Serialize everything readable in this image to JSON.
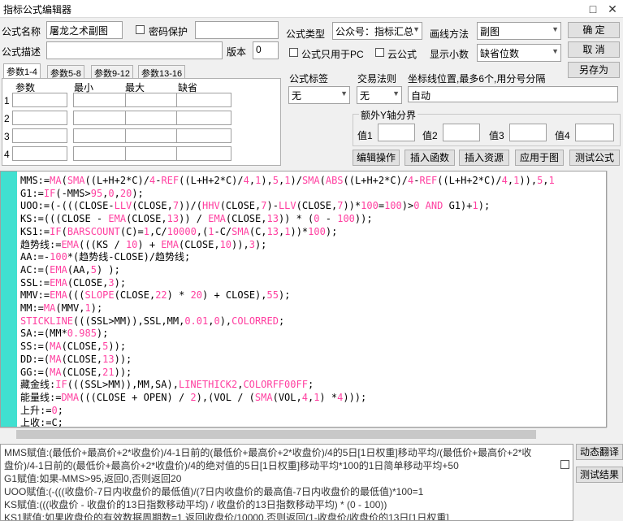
{
  "window": {
    "title": "指标公式编辑器",
    "restore_glyph": "□",
    "close_glyph": "✕"
  },
  "form": {
    "name_label": "公式名称",
    "name_value": "屠龙之术副图",
    "password_label": "密码保护",
    "desc_label": "公式描述",
    "version_label": "版本",
    "version_value": "0",
    "type_label": "公式类型",
    "type_value": "公众号：指标汇总",
    "pc_only_label": "公式只用于PC",
    "cloud_label": "云公式",
    "draw_method_label": "画线方法",
    "draw_method_value": "副图",
    "decimal_label": "显示小数",
    "decimal_value": "缺省位数"
  },
  "buttons": {
    "ok": "确  定",
    "cancel": "取  消",
    "save_as": "另存为",
    "edit_op": "编辑操作",
    "insert_func": "插入函数",
    "insert_res": "插入资源",
    "apply_chart": "应用于图",
    "test_formula": "测试公式",
    "dynamic_translate": "动态翻译",
    "test_result": "测试结果"
  },
  "tabs": [
    "参数1-4",
    "参数5-8",
    "参数9-12",
    "参数13-16"
  ],
  "param_headers": [
    "参数",
    "最小",
    "最大",
    "缺省"
  ],
  "param_rows": [
    "1",
    "2",
    "3",
    "4"
  ],
  "tag": {
    "label": "公式标签",
    "value": "无"
  },
  "trade": {
    "label": "交易法则",
    "value": "无"
  },
  "axis": {
    "label": "坐标线位置,最多6个,用分号分隔",
    "value": "自动"
  },
  "yaxis": {
    "label": "额外Y轴分界",
    "v1": "值1",
    "v2": "值2",
    "v3": "值3",
    "v4": "值4"
  },
  "code": [
    [
      [
        "MMS:=",
        "t"
      ],
      [
        "MA",
        "k"
      ],
      [
        "(",
        "t"
      ],
      [
        "SMA",
        "k"
      ],
      [
        "((L+H+2*C)/",
        "t"
      ],
      [
        "4",
        "n"
      ],
      [
        "-",
        "t"
      ],
      [
        "REF",
        "k"
      ],
      [
        "((L+H+2*C)/",
        "t"
      ],
      [
        "4",
        "n"
      ],
      [
        ",",
        "t"
      ],
      [
        "1",
        "n"
      ],
      [
        "),",
        "t"
      ],
      [
        "5",
        "n"
      ],
      [
        ",",
        "t"
      ],
      [
        "1",
        "n"
      ],
      [
        ")/",
        "t"
      ],
      [
        "SMA",
        "k"
      ],
      [
        "(",
        "t"
      ],
      [
        "ABS",
        "k"
      ],
      [
        "((L+H+2*C)/",
        "t"
      ],
      [
        "4",
        "n"
      ],
      [
        "-",
        "t"
      ],
      [
        "REF",
        "k"
      ],
      [
        "((L+H+2*C)/",
        "t"
      ],
      [
        "4",
        "n"
      ],
      [
        ",",
        "t"
      ],
      [
        "1",
        "n"
      ],
      [
        ")),",
        "t"
      ],
      [
        "5",
        "n"
      ],
      [
        ",",
        "t"
      ],
      [
        "1",
        "n"
      ]
    ],
    [
      [
        "G1:=",
        "t"
      ],
      [
        "IF",
        "k"
      ],
      [
        "(-MMS>",
        "t"
      ],
      [
        "95",
        "n"
      ],
      [
        ",",
        "t"
      ],
      [
        "0",
        "n"
      ],
      [
        ",",
        "t"
      ],
      [
        "20",
        "n"
      ],
      [
        ");",
        "t"
      ]
    ],
    [
      [
        "UOO:=(-(((CLOSE-",
        "t"
      ],
      [
        "LLV",
        "k"
      ],
      [
        "(CLOSE,",
        "t"
      ],
      [
        "7",
        "n"
      ],
      [
        "))/(",
        "t"
      ],
      [
        "HHV",
        "k"
      ],
      [
        "(CLOSE,",
        "t"
      ],
      [
        "7",
        "n"
      ],
      [
        ")-",
        "t"
      ],
      [
        "LLV",
        "k"
      ],
      [
        "(CLOSE,",
        "t"
      ],
      [
        "7",
        "n"
      ],
      [
        "))*",
        "t"
      ],
      [
        "100",
        "n"
      ],
      [
        "=",
        "t"
      ],
      [
        "100",
        "n"
      ],
      [
        ")>",
        "t"
      ],
      [
        "0",
        "n"
      ],
      [
        " ",
        "t"
      ],
      [
        "AND",
        "k"
      ],
      [
        " G1)+",
        "t"
      ],
      [
        "1",
        "n"
      ],
      [
        ");",
        "t"
      ]
    ],
    [
      [
        "KS:=(((CLOSE - ",
        "t"
      ],
      [
        "EMA",
        "k"
      ],
      [
        "(CLOSE,",
        "t"
      ],
      [
        "13",
        "n"
      ],
      [
        ")) / ",
        "t"
      ],
      [
        "EMA",
        "k"
      ],
      [
        "(CLOSE,",
        "t"
      ],
      [
        "13",
        "n"
      ],
      [
        ")) * (",
        "t"
      ],
      [
        "0",
        "n"
      ],
      [
        " - ",
        "t"
      ],
      [
        "100",
        "n"
      ],
      [
        "));",
        "t"
      ]
    ],
    [
      [
        "KS1:=",
        "t"
      ],
      [
        "IF",
        "k"
      ],
      [
        "(",
        "t"
      ],
      [
        "BARSCOUNT",
        "k"
      ],
      [
        "(C)=",
        "t"
      ],
      [
        "1",
        "n"
      ],
      [
        ",C/",
        "t"
      ],
      [
        "10000",
        "n"
      ],
      [
        ",(",
        "t"
      ],
      [
        "1",
        "n"
      ],
      [
        "-C/",
        "t"
      ],
      [
        "SMA",
        "k"
      ],
      [
        "(C,",
        "t"
      ],
      [
        "13",
        "n"
      ],
      [
        ",",
        "t"
      ],
      [
        "1",
        "n"
      ],
      [
        "))*",
        "t"
      ],
      [
        "100",
        "n"
      ],
      [
        ");",
        "t"
      ]
    ],
    [
      [
        "趋势线:=",
        "t"
      ],
      [
        "EMA",
        "k"
      ],
      [
        "(((KS / ",
        "t"
      ],
      [
        "10",
        "n"
      ],
      [
        ") + ",
        "t"
      ],
      [
        "EMA",
        "k"
      ],
      [
        "(CLOSE,",
        "t"
      ],
      [
        "10",
        "n"
      ],
      [
        ")),",
        "t"
      ],
      [
        "3",
        "n"
      ],
      [
        ");",
        "t"
      ]
    ],
    [
      [
        "AA:=-",
        "t"
      ],
      [
        "100",
        "n"
      ],
      [
        "*(趋势线-CLOSE)/趋势线;",
        "t"
      ]
    ],
    [
      [
        "AC:=(",
        "t"
      ],
      [
        "EMA",
        "k"
      ],
      [
        "(AA,",
        "t"
      ],
      [
        "5",
        "n"
      ],
      [
        ") );",
        "t"
      ]
    ],
    [
      [
        "SSL:=",
        "t"
      ],
      [
        "EMA",
        "k"
      ],
      [
        "(CLOSE,",
        "t"
      ],
      [
        "3",
        "n"
      ],
      [
        ");",
        "t"
      ]
    ],
    [
      [
        "MMV:=",
        "t"
      ],
      [
        "EMA",
        "k"
      ],
      [
        "(((",
        "t"
      ],
      [
        "SLOPE",
        "k"
      ],
      [
        "(CLOSE,",
        "t"
      ],
      [
        "22",
        "n"
      ],
      [
        ") * ",
        "t"
      ],
      [
        "20",
        "n"
      ],
      [
        ") + CLOSE),",
        "t"
      ],
      [
        "55",
        "n"
      ],
      [
        ");",
        "t"
      ]
    ],
    [
      [
        "MM:=",
        "t"
      ],
      [
        "MA",
        "k"
      ],
      [
        "(MMV,",
        "t"
      ],
      [
        "1",
        "n"
      ],
      [
        ");",
        "t"
      ]
    ],
    [
      [
        "STICKLINE",
        "k"
      ],
      [
        "(((SSL>MM)),SSL,MM,",
        "t"
      ],
      [
        "0.01",
        "n"
      ],
      [
        ",",
        "t"
      ],
      [
        "0",
        "n"
      ],
      [
        "),",
        "t"
      ],
      [
        "COLORRED",
        "k"
      ],
      [
        ";",
        "t"
      ]
    ],
    [
      [
        "SA:=(MM*",
        "t"
      ],
      [
        "0.985",
        "n"
      ],
      [
        ");",
        "t"
      ]
    ],
    [
      [
        "SS:=(",
        "t"
      ],
      [
        "MA",
        "k"
      ],
      [
        "(CLOSE,",
        "t"
      ],
      [
        "5",
        "n"
      ],
      [
        "));",
        "t"
      ]
    ],
    [
      [
        "DD:=(",
        "t"
      ],
      [
        "MA",
        "k"
      ],
      [
        "(CLOSE,",
        "t"
      ],
      [
        "13",
        "n"
      ],
      [
        "));",
        "t"
      ]
    ],
    [
      [
        "GG:=(",
        "t"
      ],
      [
        "MA",
        "k"
      ],
      [
        "(CLOSE,",
        "t"
      ],
      [
        "21",
        "n"
      ],
      [
        "));",
        "t"
      ]
    ],
    [
      [
        "藏金线:",
        "t"
      ],
      [
        "IF",
        "k"
      ],
      [
        "(((SSL>MM)),MM,SA),",
        "t"
      ],
      [
        "LINETHICK2",
        "k"
      ],
      [
        ",",
        "t"
      ],
      [
        "COLORFF00FF",
        "k"
      ],
      [
        ";",
        "t"
      ]
    ],
    [
      [
        "能量线:=",
        "t"
      ],
      [
        "DMA",
        "k"
      ],
      [
        "(((CLOSE + OPEN) / ",
        "t"
      ],
      [
        "2",
        "n"
      ],
      [
        "),(VOL / (",
        "t"
      ],
      [
        "SMA",
        "k"
      ],
      [
        "(VOL,",
        "t"
      ],
      [
        "4",
        "n"
      ],
      [
        ",",
        "t"
      ],
      [
        "1",
        "n"
      ],
      [
        ") *",
        "t"
      ],
      [
        "4",
        "n"
      ],
      [
        ")));",
        "t"
      ]
    ],
    [
      [
        "上升:=",
        "t"
      ],
      [
        "0",
        "n"
      ],
      [
        ";",
        "t"
      ]
    ],
    [
      [
        "上收:=C;",
        "t"
      ]
    ]
  ],
  "explain": [
    "MMS赋值:(最低价+最高价+2*收盘价)/4-1日前的(最低价+最高价+2*收盘价)/4的5日[1日权重]移动平均/(最低价+最高价+2*收",
    "盘价)/4-1日前的(最低价+最高价+2*收盘价)/4的绝对值的5日[1日权重]移动平均*100的1日简单移动平均+50",
    "G1赋值:如果-MMS>95,返回0,否则返回20",
    "UOO赋值:(-(((收盘价-7日内收盘价的最低值)/(7日内收盘价的最高值-7日内收盘价的最低值)*100=1",
    "KS赋值:(((收盘价 - 收盘价的13日指数移动平均) / 收盘价的13日指数移动平均) * (0 - 100))",
    "KS1赋值:如果收盘价的有效数据周期数=1,返回收盘价/10000,否则返回(1-收盘价/收盘价的13日[1日权重]"
  ]
}
